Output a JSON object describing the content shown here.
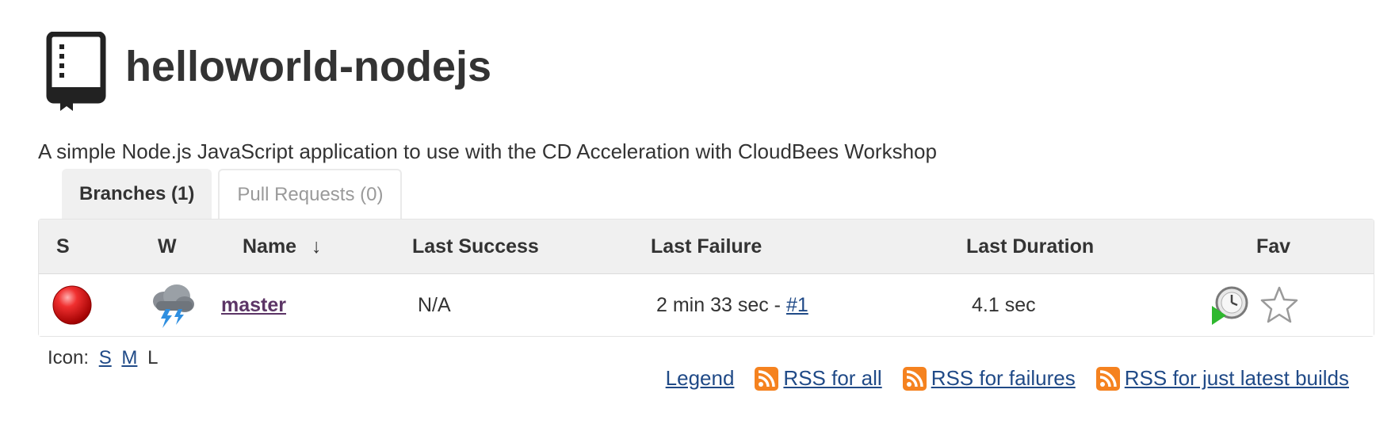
{
  "header": {
    "title": "helloworld-nodejs",
    "icon": "multibranch-book-icon"
  },
  "description": "A simple Node.js JavaScript application to use with the CD Acceleration with CloudBees Workshop",
  "tabs": [
    {
      "label": "Branches (1)",
      "active": true
    },
    {
      "label": "Pull Requests (0)",
      "active": false
    }
  ],
  "table": {
    "columns": {
      "s": "S",
      "w": "W",
      "name": "Name",
      "sort_arrow": "↓",
      "last_success": "Last Success",
      "last_failure": "Last Failure",
      "last_duration": "Last Duration",
      "fav": "Fav"
    },
    "rows": [
      {
        "status_icon": "red-ball-icon",
        "weather_icon": "thunderstorm-icon",
        "name": "master",
        "last_success": "N/A",
        "last_failure": "2 min 33 sec - ",
        "last_failure_build": "#1",
        "last_duration": "4.1 sec",
        "actions_icons": [
          "schedule-build-icon",
          "favorite-star-icon"
        ]
      }
    ]
  },
  "icon_size": {
    "label": "Icon:",
    "options": [
      "S",
      "M",
      "L"
    ],
    "current": "L"
  },
  "footer": {
    "legend": "Legend",
    "rss_all": "RSS for all",
    "rss_failures": "RSS for failures",
    "rss_latest": "RSS for just latest builds"
  },
  "colors": {
    "link": "#204a87",
    "job_link": "#5c3566",
    "header_bg": "#f0f0f0",
    "rss": "#f5821f",
    "status_red": "#e02020"
  }
}
